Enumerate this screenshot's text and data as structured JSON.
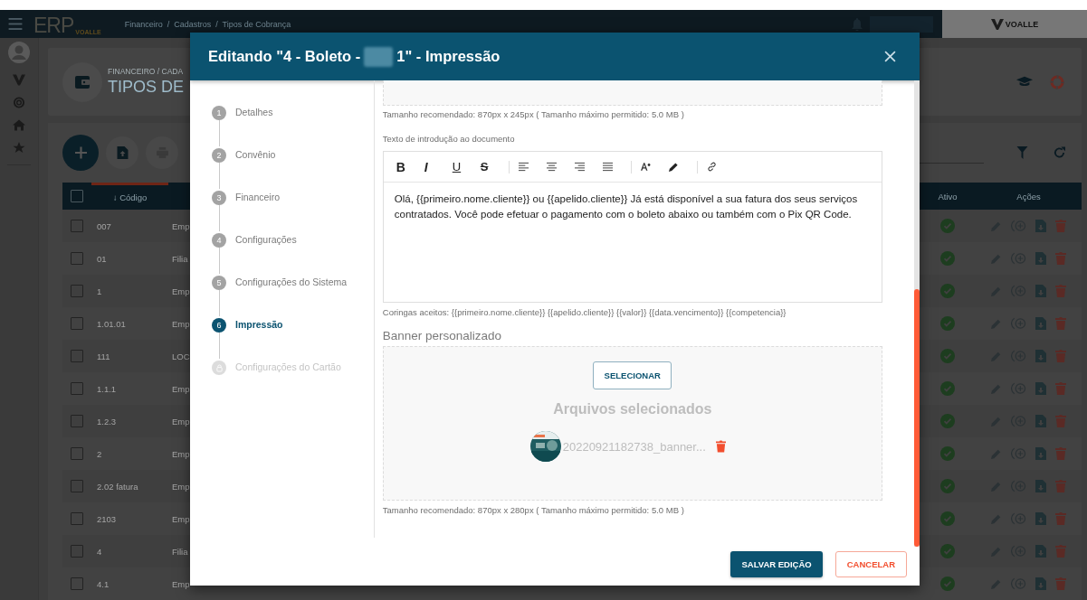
{
  "topbar": {
    "logo": "ERP",
    "logo_sub": "VOALLE",
    "breadcrumb": "Financeiro  /  Cadastros  /  Tipos de Cobrança",
    "brand": "VOALLE"
  },
  "page_header": {
    "section": "FINANCEIRO / CADA",
    "title": "TIPOS DE"
  },
  "table": {
    "select_all_checked": false,
    "columns": [
      "↓ Código",
      "Ativo",
      "Ações"
    ],
    "rows": [
      {
        "checked": false,
        "code": "007",
        "column_2": "Emp",
        "active": true
      },
      {
        "checked": false,
        "code": "01",
        "column_2": "Filia",
        "active": true
      },
      {
        "checked": false,
        "code": "1",
        "column_2": "Emp",
        "active": true
      },
      {
        "checked": false,
        "code": "1.01.01",
        "column_2": "Emp",
        "active": true
      },
      {
        "checked": false,
        "code": "111",
        "column_2": "LOC",
        "active": true
      },
      {
        "checked": false,
        "code": "1.1.1",
        "column_2": "Emp",
        "active": true
      },
      {
        "checked": false,
        "code": "1.2.3",
        "column_2": "Emp",
        "active": true
      },
      {
        "checked": false,
        "code": "2",
        "column_2": "Emp",
        "active": true
      },
      {
        "checked": false,
        "code": "2.02 fatura",
        "column_2": "Emp",
        "active": true
      },
      {
        "checked": false,
        "code": "2103",
        "column_2": "Emp",
        "active": true
      },
      {
        "checked": false,
        "code": "4",
        "column_2": "Filia",
        "active": true
      },
      {
        "checked": false,
        "code": "4.1",
        "column_2": "Emp",
        "active": true
      }
    ]
  },
  "modal": {
    "title_start": "Editando \"4 - Boleto -",
    "title_end": "1\" - Impressão",
    "steps": [
      {
        "number": "1",
        "label": "Detalhes",
        "selected": false,
        "locked": false
      },
      {
        "number": "2",
        "label": "Convênio",
        "selected": false,
        "locked": false
      },
      {
        "number": "3",
        "label": "Financeiro",
        "selected": false,
        "locked": false
      },
      {
        "number": "4",
        "label": "Configurações",
        "selected": false,
        "locked": false
      },
      {
        "number": "5",
        "label": "Configurações do Sistema",
        "selected": false,
        "locked": false
      },
      {
        "number": "6",
        "label": "Impressão",
        "selected": true,
        "locked": false
      },
      {
        "label": "Configurações do Cartão",
        "selected": false,
        "locked": true
      }
    ],
    "header_size_note": "Tamanho recomendado: 870px x 245px ( Tamanho máximo permitido: 5.0 MB )",
    "intro_label": "Texto de introdução ao documento",
    "toolbar": [
      {
        "kind": "bold",
        "label": "B"
      },
      {
        "kind": "italic",
        "label": "I"
      },
      {
        "kind": "underline",
        "label": "U"
      },
      {
        "kind": "strike",
        "label": "S"
      },
      {
        "kind": "separator"
      },
      {
        "kind": "align-left"
      },
      {
        "kind": "align-center"
      },
      {
        "kind": "align-right"
      },
      {
        "kind": "justify"
      },
      {
        "kind": "separator"
      },
      {
        "kind": "font-size"
      },
      {
        "kind": "pen"
      },
      {
        "kind": "separator"
      },
      {
        "kind": "link"
      }
    ],
    "intro_text": "Olá, {{primeiro.nome.cliente}} ou {{apelido.cliente}} Já está disponível a sua fatura dos seus serviços contratados. Você pode efetuar o pagamento com o boleto abaixo ou também com o Pix QR Code.",
    "wildcards": "Coringas aceitos: {{primeiro.nome.cliente}} {{apelido.cliente}} {{valor}} {{data.vencimento}} {{competencia}}",
    "banner_label": "Banner personalizado",
    "select_button": "SELECIONAR",
    "files_heading": "Arquivos selecionados",
    "files": [
      {
        "name": "20220921182738_banner..."
      }
    ],
    "banner_size_note": "Tamanho recomendado: 870px x 280px ( Tamanho máximo permitido: 5.0 MB )",
    "buttons": [
      {
        "kind": "primary",
        "label": "SALVAR EDIÇÃO"
      },
      {
        "kind": "cancel",
        "label": "CANCELAR"
      }
    ]
  }
}
